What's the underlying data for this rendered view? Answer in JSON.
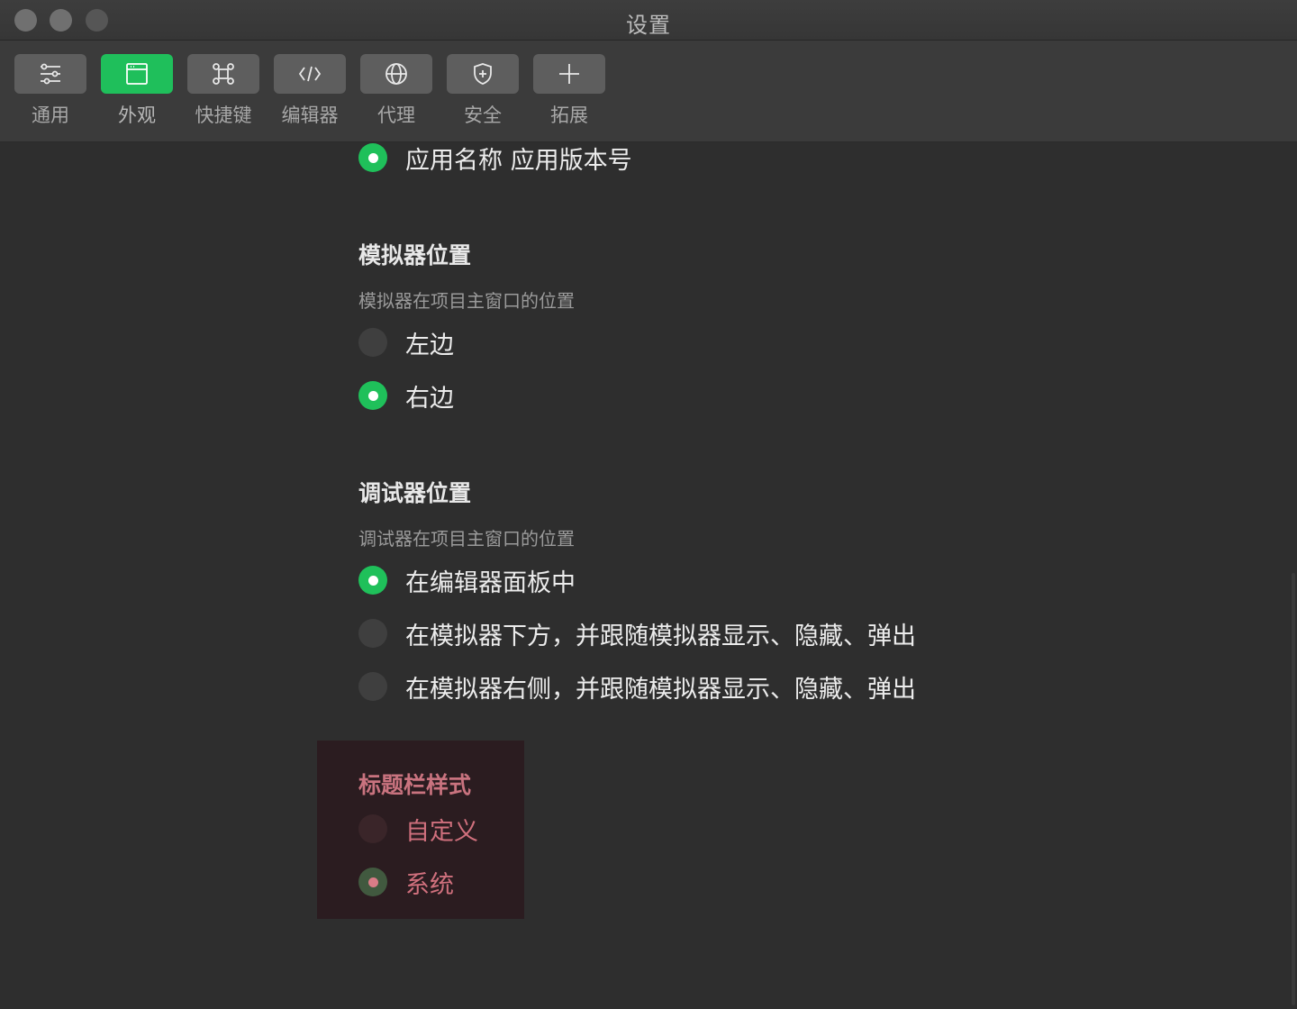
{
  "window": {
    "title": "设置"
  },
  "toolbar": {
    "items": [
      {
        "label": "通用",
        "icon": "sliders-icon",
        "active": false
      },
      {
        "label": "外观",
        "icon": "window-icon",
        "active": true
      },
      {
        "label": "快捷键",
        "icon": "command-icon",
        "active": false
      },
      {
        "label": "编辑器",
        "icon": "code-icon",
        "active": false
      },
      {
        "label": "代理",
        "icon": "globe-icon",
        "active": false
      },
      {
        "label": "安全",
        "icon": "shield-icon",
        "active": false
      },
      {
        "label": "拓展",
        "icon": "plus-icon",
        "active": false
      }
    ]
  },
  "top_option": {
    "label": "应用名称 应用版本号",
    "checked": true
  },
  "simulator_position": {
    "title": "模拟器位置",
    "description": "模拟器在项目主窗口的位置",
    "options": [
      {
        "label": "左边",
        "checked": false
      },
      {
        "label": "右边",
        "checked": true
      }
    ]
  },
  "debugger_position": {
    "title": "调试器位置",
    "description": "调试器在项目主窗口的位置",
    "options": [
      {
        "label": "在编辑器面板中",
        "checked": true
      },
      {
        "label": "在模拟器下方，并跟随模拟器显示、隐藏、弹出",
        "checked": false
      },
      {
        "label": "在模拟器右侧，并跟随模拟器显示、隐藏、弹出",
        "checked": false
      }
    ]
  },
  "titlebar_style": {
    "title": "标题栏样式",
    "options": [
      {
        "label": "自定义",
        "checked": false
      },
      {
        "label": "系统",
        "checked": true
      }
    ]
  },
  "colors": {
    "accent": "#1fc05a",
    "highlight_text": "#d0707d",
    "background": "#2e2e2e"
  }
}
